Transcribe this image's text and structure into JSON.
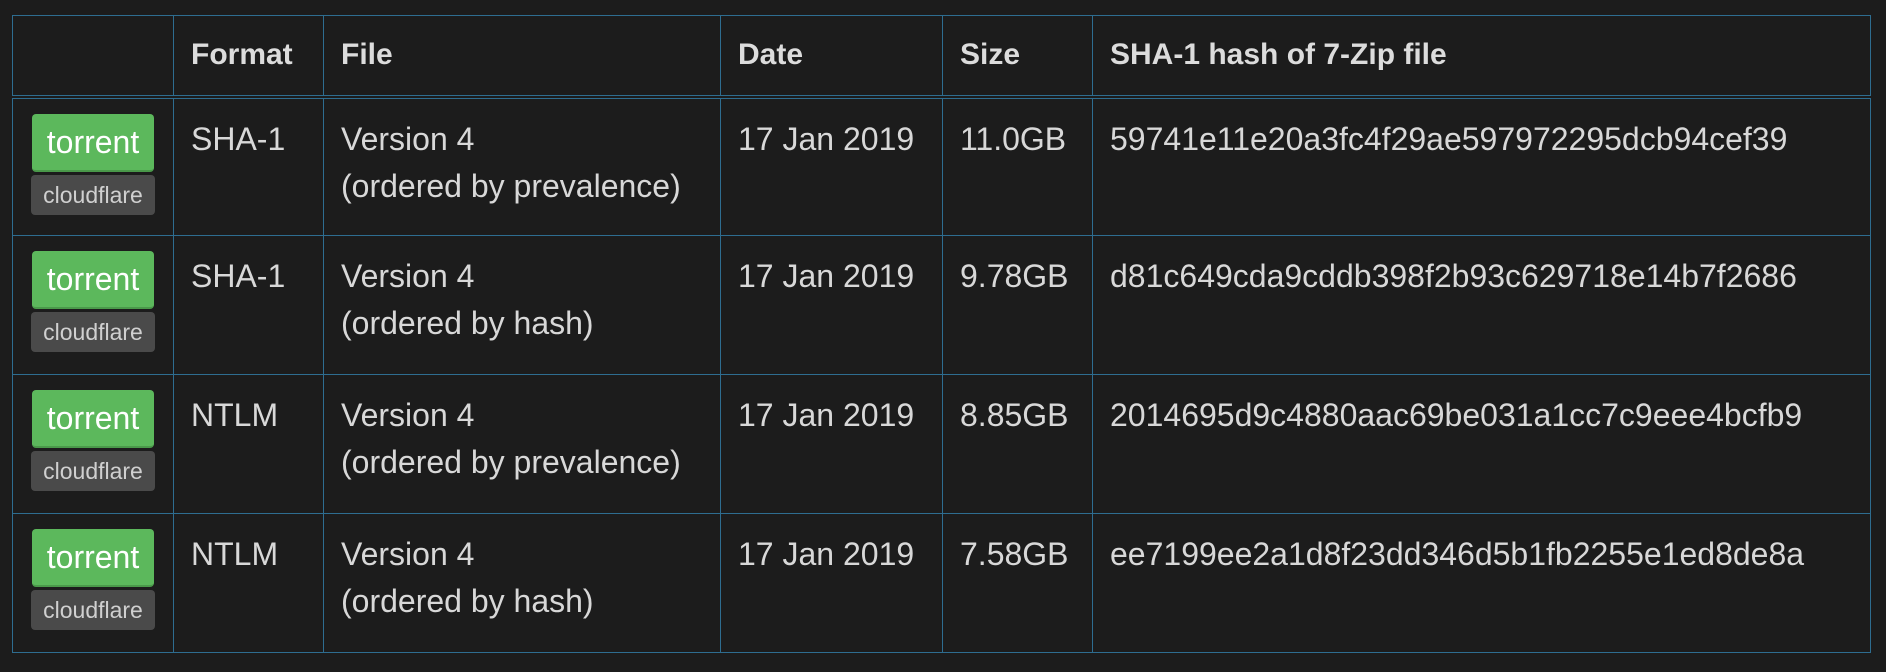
{
  "table": {
    "headers": [
      "",
      "Format",
      "File",
      "Date",
      "Size",
      "SHA-1 hash of 7-Zip file"
    ],
    "rows": [
      {
        "torrent_label": "torrent",
        "mirror_label": "cloudflare",
        "format": "SHA-1",
        "file_line1": "Version 4",
        "file_line2": "(ordered by prevalence)",
        "date": "17 Jan 2019",
        "size": "11.0GB",
        "hash": "59741e11e20a3fc4f29ae597972295dcb94cef39"
      },
      {
        "torrent_label": "torrent",
        "mirror_label": "cloudflare",
        "format": "SHA-1",
        "file_line1": "Version 4",
        "file_line2": "(ordered by hash)",
        "date": "17 Jan 2019",
        "size": "9.78GB",
        "hash": "d81c649cda9cddb398f2b93c629718e14b7f2686"
      },
      {
        "torrent_label": "torrent",
        "mirror_label": "cloudflare",
        "format": "NTLM",
        "file_line1": "Version 4",
        "file_line2": "(ordered by prevalence)",
        "date": "17 Jan 2019",
        "size": "8.85GB",
        "hash": "2014695d9c4880aac69be031a1cc7c9eee4bcfb9"
      },
      {
        "torrent_label": "torrent",
        "mirror_label": "cloudflare",
        "format": "NTLM",
        "file_line1": "Version 4",
        "file_line2": "(ordered by hash)",
        "date": "17 Jan 2019",
        "size": "7.58GB",
        "hash": "ee7199ee2a1d8f23dd346d5b1fb2255e1ed8de8a"
      }
    ]
  },
  "colors": {
    "background": "#1c1c1c",
    "border": "#2e6d90",
    "torrent_button": "#5cb85c",
    "mirror_button": "#4a4a4a",
    "text": "#d8d8d8"
  }
}
